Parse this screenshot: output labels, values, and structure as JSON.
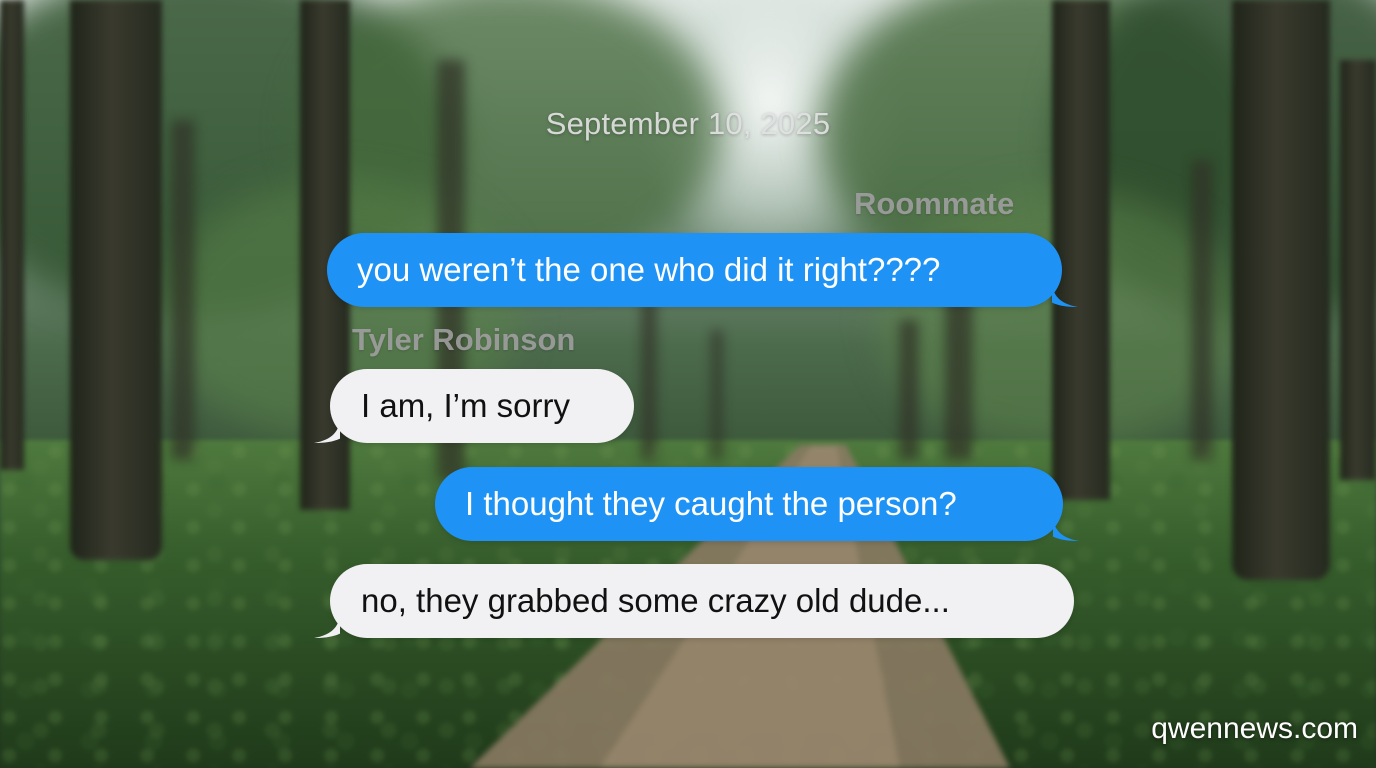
{
  "conversation": {
    "date": "September 10, 2025",
    "contacts": {
      "roommate": "Roommate",
      "tyler": "Tyler Robinson"
    },
    "messages": [
      {
        "text": "you weren’t the one who did it right????",
        "direction": "sent"
      },
      {
        "text": "I am, I’m sorry",
        "direction": "received"
      },
      {
        "text": "I thought they caught the person?",
        "direction": "sent"
      },
      {
        "text": "no, they grabbed some crazy old dude...",
        "direction": "received"
      }
    ]
  },
  "watermark": "qwennews.com",
  "colors": {
    "sent_bubble": "#1e93f5",
    "received_bubble": "#f1f1f3"
  }
}
